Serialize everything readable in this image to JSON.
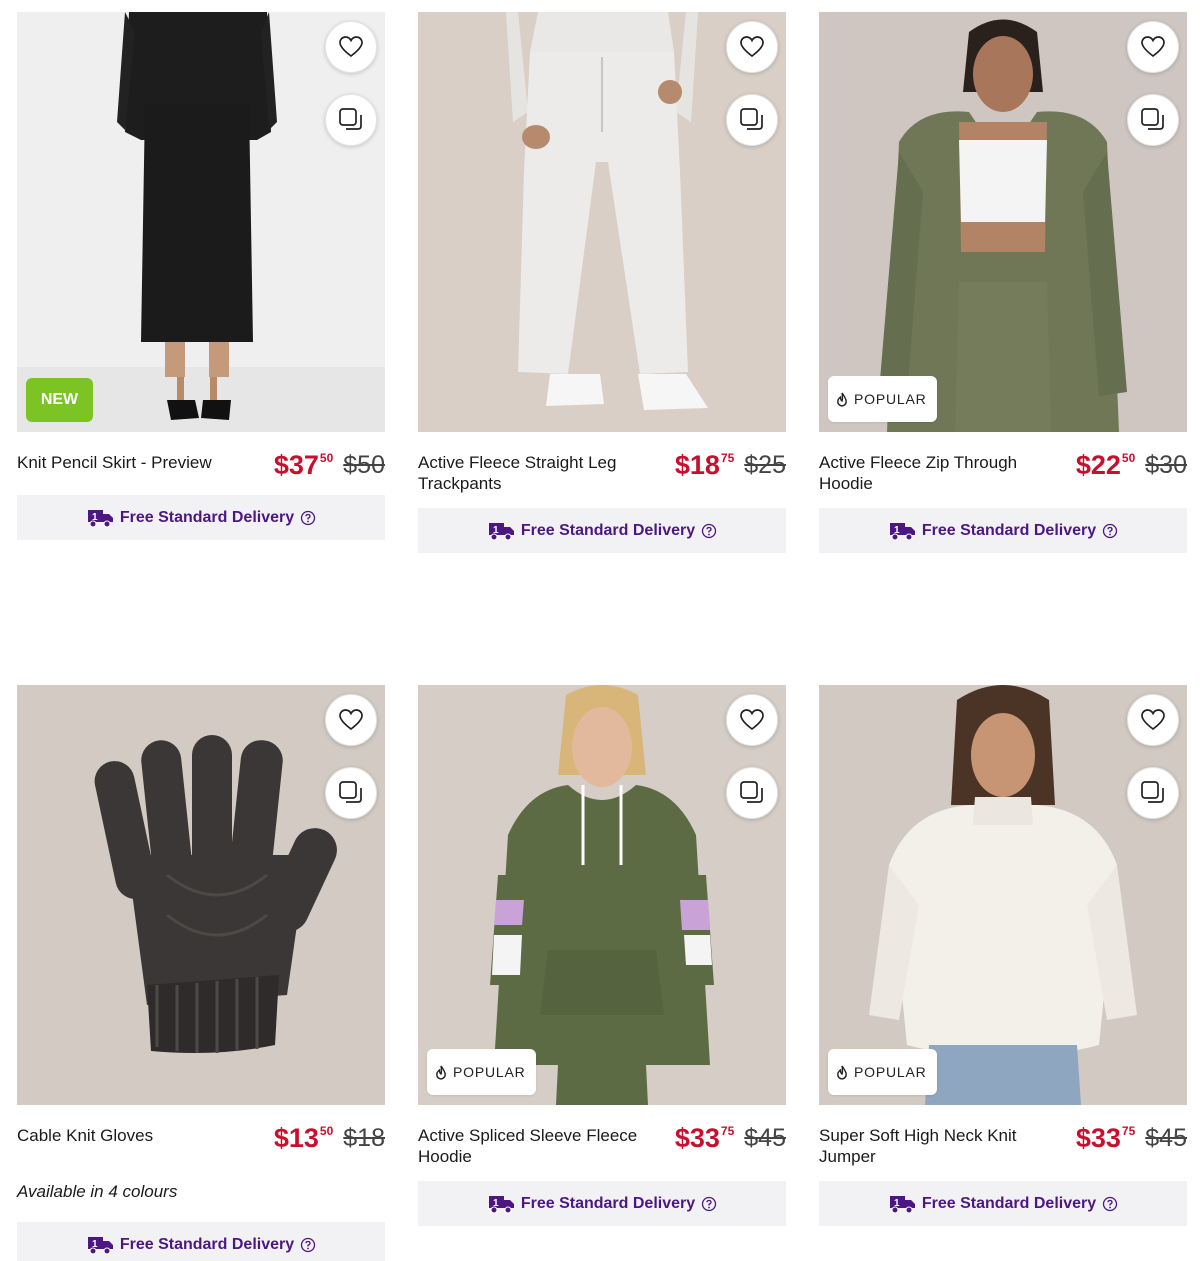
{
  "colors": {
    "price": "#c8102e",
    "delivery_text": "#4c1783",
    "new_badge": "#7cc424"
  },
  "products": [
    {
      "title": "Knit Pencil Skirt - Preview",
      "price_dollars": "$37",
      "price_cents": "50",
      "was_price": "$50",
      "badge": "NEW",
      "delivery_label": "Free Standard Delivery"
    },
    {
      "title": "Active Fleece Straight Leg Trackpants",
      "price_dollars": "$18",
      "price_cents": "75",
      "was_price": "$25",
      "delivery_label": "Free Standard Delivery"
    },
    {
      "title": "Active Fleece Zip Through Hoodie",
      "price_dollars": "$22",
      "price_cents": "50",
      "was_price": "$30",
      "badge": "POPULAR",
      "delivery_label": "Free Standard Delivery"
    },
    {
      "title": "Cable Knit Gloves",
      "price_dollars": "$13",
      "price_cents": "50",
      "was_price": "$18",
      "colours_note": "Available in 4 colours",
      "delivery_label": "Free Standard Delivery"
    },
    {
      "title": "Active Spliced Sleeve Fleece Hoodie",
      "price_dollars": "$33",
      "price_cents": "75",
      "was_price": "$45",
      "badge": "POPULAR",
      "delivery_label": "Free Standard Delivery"
    },
    {
      "title": "Super Soft High Neck Knit Jumper",
      "price_dollars": "$33",
      "price_cents": "75",
      "was_price": "$45",
      "badge": "POPULAR",
      "delivery_label": "Free Standard Delivery"
    }
  ],
  "icons": {
    "wishlist": "heart-icon",
    "compare": "compare-icon",
    "popular": "flame-icon",
    "delivery": "delivery-truck-icon",
    "help": "question-icon"
  }
}
